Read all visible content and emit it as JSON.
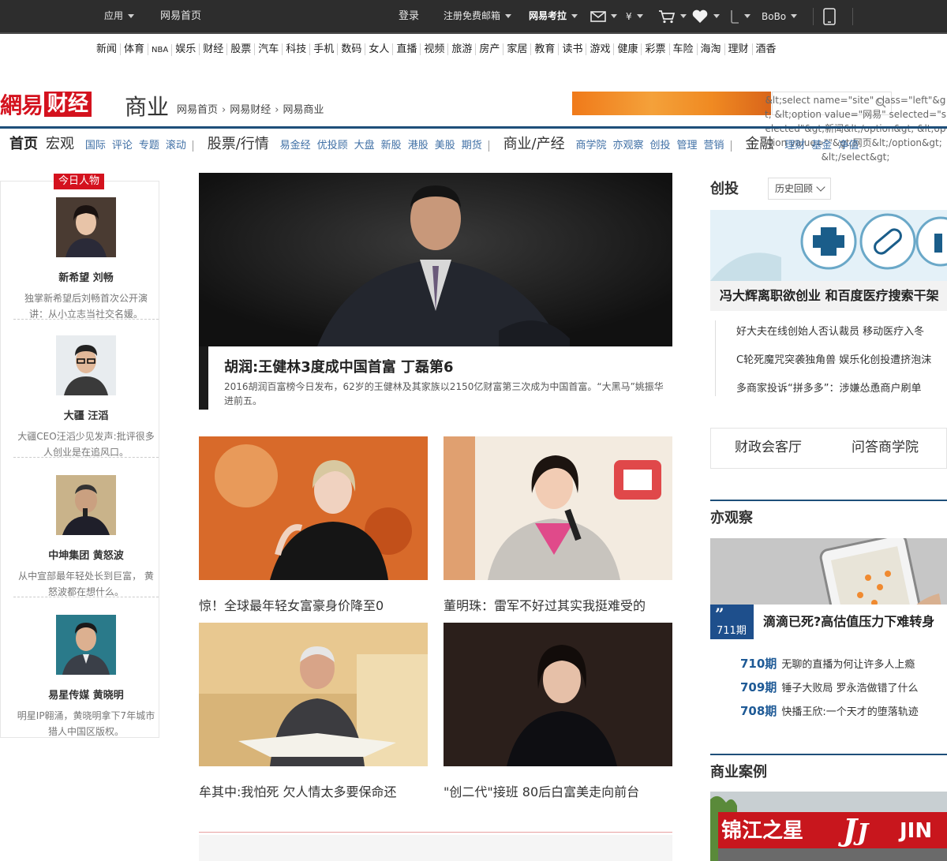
{
  "topbar": {
    "apps": "应用",
    "home": "网易首页",
    "login": "登录",
    "register": "注册免费邮箱",
    "kaola": "网易考拉",
    "bobo": "BoBo"
  },
  "channels": [
    "新闻",
    "体育",
    "NBA",
    "娱乐",
    "财经",
    "股票",
    "汽车",
    "科技",
    "手机",
    "数码",
    "女人",
    "直播",
    "视频",
    "旅游",
    "房产",
    "家居",
    "教育",
    "读书",
    "游戏",
    "健康",
    "彩票",
    "车险",
    "海淘",
    "理财",
    "酒香"
  ],
  "header": {
    "logo_wy": "網易",
    "logo_cj": "财经",
    "section": "商业",
    "breadcrumb": [
      "网易首页",
      "网易财经",
      "网易商业"
    ],
    "select_raw": "&lt;select name=\"site\" class=\"left\"&gt; &lt;option value=\"网易\" selected=\"selected\"&gt;新闻&lt;/option&gt; &lt;option value=\"\"&gt;网页&lt;/option&gt; &lt;/select&gt;"
  },
  "subnav": {
    "g1": {
      "a": "首页",
      "b": "宏观"
    },
    "g1_links": [
      "国际",
      "评论",
      "专题",
      "滚动"
    ],
    "g2": "股票/行情",
    "g2_links": [
      "易金经",
      "优投顾",
      "大盘",
      "新股",
      "港股",
      "美股",
      "期货"
    ],
    "g3": "商业/产经",
    "g3_links": [
      "商学院",
      "亦观察",
      "创投",
      "管理",
      "营销"
    ],
    "g4": "金融",
    "g4_links": [
      "理财",
      "基金",
      "净值"
    ]
  },
  "people": {
    "tag": "今日人物",
    "items": [
      {
        "name": "新希望 刘畅",
        "desc": "独掌新希望后刘畅首次公开演讲：从小立志当社交名媛。"
      },
      {
        "name": "大疆 汪滔",
        "desc": "大疆CEO汪滔少见发声:批评很多人创业是在追风口。"
      },
      {
        "name": "中坤集团 黄怒波",
        "desc": "从中宣部最年轻处长到巨富， 黄怒波都在想什么。"
      },
      {
        "name": "易星传媒 黄晓明",
        "desc": "明星IP翱涌，黄晓明拿下7年城市猎人中国区版权。"
      }
    ]
  },
  "hero": {
    "title": "胡润:王健林3度成中国首富 丁磊第6",
    "desc": "2016胡润百富榜今日发布，62岁的王健林及其家族以2150亿财富第三次成为中国首富。“大黑马”姚振华进前五。"
  },
  "cards": [
    {
      "caption": "惊！全球最年轻女富豪身价降至0"
    },
    {
      "caption": "董明珠：雷军不好过其实我挺难受的"
    },
    {
      "caption": "牟其中:我怕死 欠人情太多要保命还"
    },
    {
      "caption": "\"创二代\"接班 80后白富美走向前台"
    }
  ],
  "chuangtou": {
    "title": "创投",
    "history": "历史回顾",
    "headline": "冯大辉离职欲创业 和百度医疗搜索干架",
    "list": [
      "好大夫在线创始人否认裁员 移动医疗入冬",
      "C轮死魔咒突袭独角兽 娱乐化创投遭挤泡沫",
      "多商家投诉“拼多多”：涉嫌怂恿商户刷单"
    ]
  },
  "tabs": [
    "财政会客厅",
    "问答商学院"
  ],
  "yiguancha": {
    "title": "亦观察",
    "issue": "711期",
    "headline": "滴滴已死?高估值压力下难转身",
    "list": [
      {
        "num": "710期",
        "text": "无聊的直播为何让许多人上瘾"
      },
      {
        "num": "709期",
        "text": "锤子大败局 罗永浩做错了什么"
      },
      {
        "num": "708期",
        "text": "快播王欣:一个天才的堕落轨迹"
      }
    ]
  },
  "cases": {
    "title": "商业案例",
    "sign": "锦江之星"
  },
  "colors": {
    "brand_red": "#d4121e",
    "nav_blue": "#3f6fa5",
    "rule_blue": "#1e4f7a"
  }
}
